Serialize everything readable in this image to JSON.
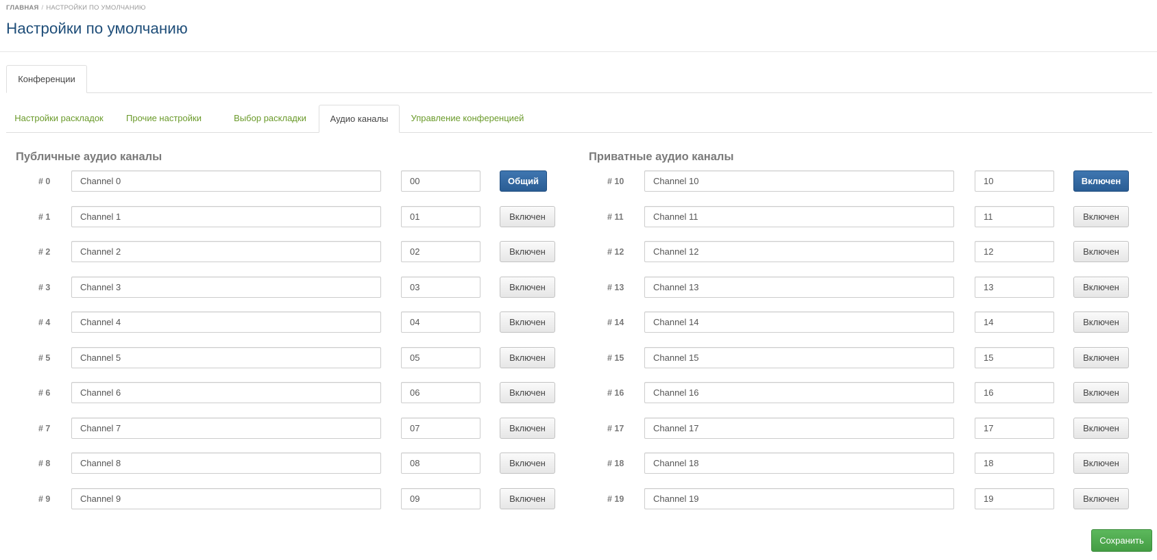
{
  "breadcrumb": {
    "home": "ГЛАВНАЯ",
    "separator": "/",
    "current": "НАСТРОЙКИ ПО УМОЛЧАНИЮ"
  },
  "page_title": "Настройки по умолчанию",
  "top_tabs": [
    {
      "label": "Конференции",
      "active": true
    }
  ],
  "sub_tabs": [
    {
      "label": "Настройки раскладок",
      "active": false
    },
    {
      "label": "Прочие настройки",
      "active": false
    },
    {
      "label": "Выбор раскладки",
      "active": false
    },
    {
      "label": "Аудио каналы",
      "active": true
    },
    {
      "label": "Управление конференцией",
      "active": false
    }
  ],
  "public_channels": {
    "title": "Публичные аудио каналы",
    "rows": [
      {
        "num": "# 0",
        "name": "Channel 0",
        "code": "00",
        "button": "Общий",
        "primary": true
      },
      {
        "num": "# 1",
        "name": "Channel 1",
        "code": "01",
        "button": "Включен",
        "primary": false
      },
      {
        "num": "# 2",
        "name": "Channel 2",
        "code": "02",
        "button": "Включен",
        "primary": false
      },
      {
        "num": "# 3",
        "name": "Channel 3",
        "code": "03",
        "button": "Включен",
        "primary": false
      },
      {
        "num": "# 4",
        "name": "Channel 4",
        "code": "04",
        "button": "Включен",
        "primary": false
      },
      {
        "num": "# 5",
        "name": "Channel 5",
        "code": "05",
        "button": "Включен",
        "primary": false
      },
      {
        "num": "# 6",
        "name": "Channel 6",
        "code": "06",
        "button": "Включен",
        "primary": false
      },
      {
        "num": "# 7",
        "name": "Channel 7",
        "code": "07",
        "button": "Включен",
        "primary": false
      },
      {
        "num": "# 8",
        "name": "Channel 8",
        "code": "08",
        "button": "Включен",
        "primary": false
      },
      {
        "num": "# 9",
        "name": "Channel 9",
        "code": "09",
        "button": "Включен",
        "primary": false
      }
    ]
  },
  "private_channels": {
    "title": "Приватные аудио каналы",
    "rows": [
      {
        "num": "# 10",
        "name": "Channel 10",
        "code": "10",
        "button": "Включен",
        "primary": true
      },
      {
        "num": "# 11",
        "name": "Channel 11",
        "code": "11",
        "button": "Включен",
        "primary": false
      },
      {
        "num": "# 12",
        "name": "Channel 12",
        "code": "12",
        "button": "Включен",
        "primary": false
      },
      {
        "num": "# 13",
        "name": "Channel 13",
        "code": "13",
        "button": "Включен",
        "primary": false
      },
      {
        "num": "# 14",
        "name": "Channel 14",
        "code": "14",
        "button": "Включен",
        "primary": false
      },
      {
        "num": "# 15",
        "name": "Channel 15",
        "code": "15",
        "button": "Включен",
        "primary": false
      },
      {
        "num": "# 16",
        "name": "Channel 16",
        "code": "16",
        "button": "Включен",
        "primary": false
      },
      {
        "num": "# 17",
        "name": "Channel 17",
        "code": "17",
        "button": "Включен",
        "primary": false
      },
      {
        "num": "# 18",
        "name": "Channel 18",
        "code": "18",
        "button": "Включен",
        "primary": false
      },
      {
        "num": "# 19",
        "name": "Channel 19",
        "code": "19",
        "button": "Включен",
        "primary": false
      }
    ]
  },
  "save_button": "Сохранить",
  "colors": {
    "title": "#1f4e79",
    "tab_link": "#6a9a2a",
    "primary": "#2a5d94",
    "success": "#449d44"
  }
}
